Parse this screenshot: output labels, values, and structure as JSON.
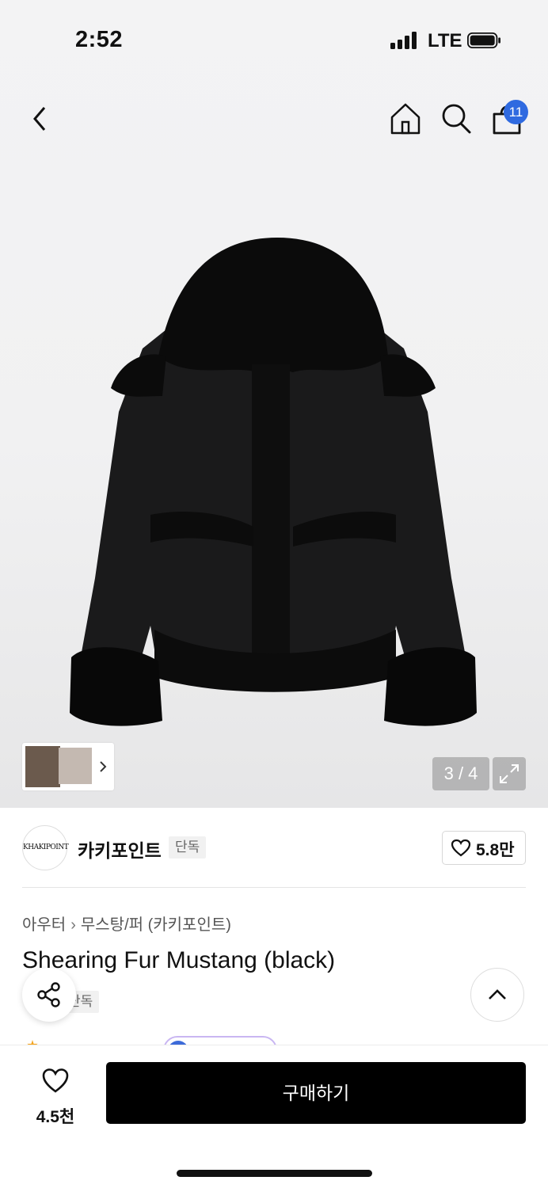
{
  "status_bar": {
    "time": "2:52",
    "network": "LTE"
  },
  "header": {
    "cart_badge": "11"
  },
  "gallery": {
    "counter": "3 / 4",
    "current_image": 3,
    "total_images": 4
  },
  "brand": {
    "logo_text": "KHAKIPOINT",
    "name": "카키포인트",
    "tag": "단독",
    "like_count": "5.8만"
  },
  "product": {
    "breadcrumb": [
      "아우터",
      "무스탕/퍼 (카키포인트)"
    ],
    "title": "Shearing Fur Mustang (black)",
    "tag": "단독"
  },
  "bottom_bar": {
    "wish_count": "4.5천",
    "buy_label": "구매하기"
  },
  "colors": {
    "accent_badge": "#2f6ae0",
    "buy_button": "#000000"
  },
  "icons": [
    "back-icon",
    "home-icon",
    "search-icon",
    "cart-icon",
    "chevron-right-icon",
    "expand-icon",
    "heart-icon",
    "share-icon",
    "chevron-up-icon"
  ]
}
